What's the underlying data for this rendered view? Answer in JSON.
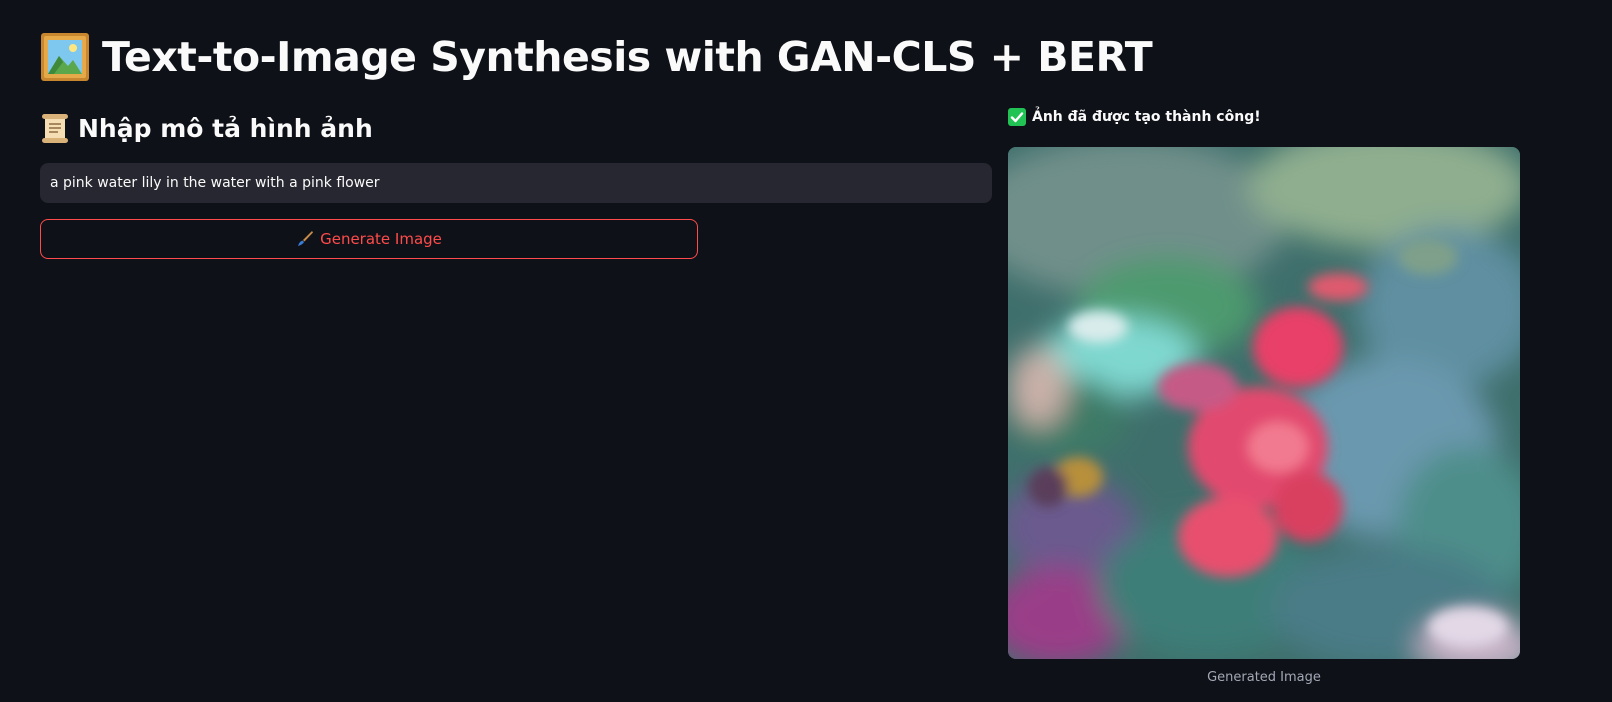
{
  "app": {
    "title": "Text-to-Image Synthesis with GAN-CLS + BERT",
    "title_icon": "framed-picture-icon"
  },
  "input_section": {
    "header": "Nhập mô tả hình ảnh",
    "header_icon": "scroll-icon",
    "prompt_value": "a pink water lily in the water with a pink flower",
    "button_label": "Generate Image",
    "button_icon": "paintbrush-icon"
  },
  "output_section": {
    "status_text": "Ảnh đã được tạo thành công!",
    "status_icon": "check-mark-icon",
    "image_caption": "Generated Image"
  },
  "colors": {
    "background": "#0e1117",
    "accent": "#ff4b4b",
    "input_background": "#262730",
    "success": "#21c354"
  }
}
